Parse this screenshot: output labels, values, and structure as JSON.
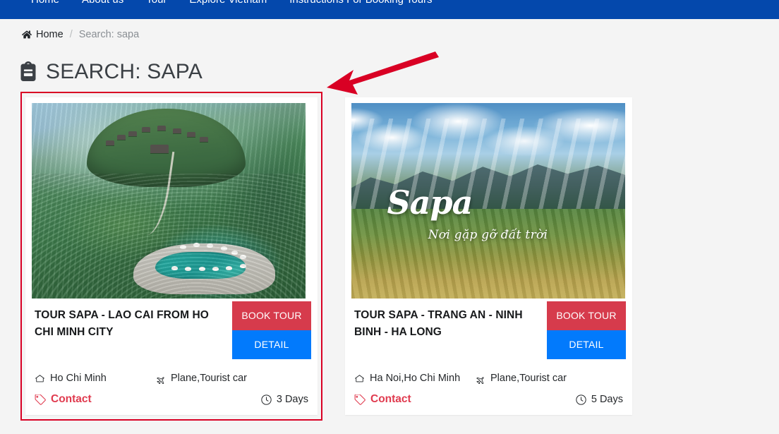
{
  "navbar": {
    "background": "#0448ac",
    "items": [
      {
        "label": "Home"
      },
      {
        "label": "About us"
      },
      {
        "label": "Tour"
      },
      {
        "label": "Explore Vietnam"
      },
      {
        "label": "Instructions For Booking Tours"
      }
    ]
  },
  "breadcrumb": {
    "home_label": "Home",
    "separator": "/",
    "current": "Search: sapa"
  },
  "heading": {
    "icon": "backpack-icon",
    "text": "SEARCH: SAPA"
  },
  "annotation": {
    "arrow_color": "#d90024",
    "highlight_color": "#d90024"
  },
  "cards": [
    {
      "title": "TOUR SAPA - LAO CAI FROM HO CHI MINH CITY",
      "image_alt": "Aerial view of terraced rice fields and hillside resort pool",
      "book_label": "BOOK TOUR",
      "detail_label": "DETAIL",
      "departure": "Ho Chi Minh",
      "transport": "Plane,Tourist car",
      "price": "Contact",
      "duration": "3 Days",
      "book_color": "#d63b4c",
      "detail_color": "#027afc",
      "price_color": "#e03b4f"
    },
    {
      "title": "TOUR SAPA - TRANG AN - NINH BINH - HA LONG",
      "image_alt": "Sapa poster with mountains, sun rays and rice fields",
      "image_overlay_title": "Sapa",
      "image_overlay_subtitle": "Nơi gặp gỡ đất trời",
      "book_label": "BOOK TOUR",
      "detail_label": "DETAIL",
      "departure": "Ha Noi,Ho Chi Minh",
      "transport": "Plane,Tourist car",
      "price": "Contact",
      "duration": "5 Days",
      "book_color": "#d63b4c",
      "detail_color": "#027afc",
      "price_color": "#e03b4f"
    }
  ]
}
